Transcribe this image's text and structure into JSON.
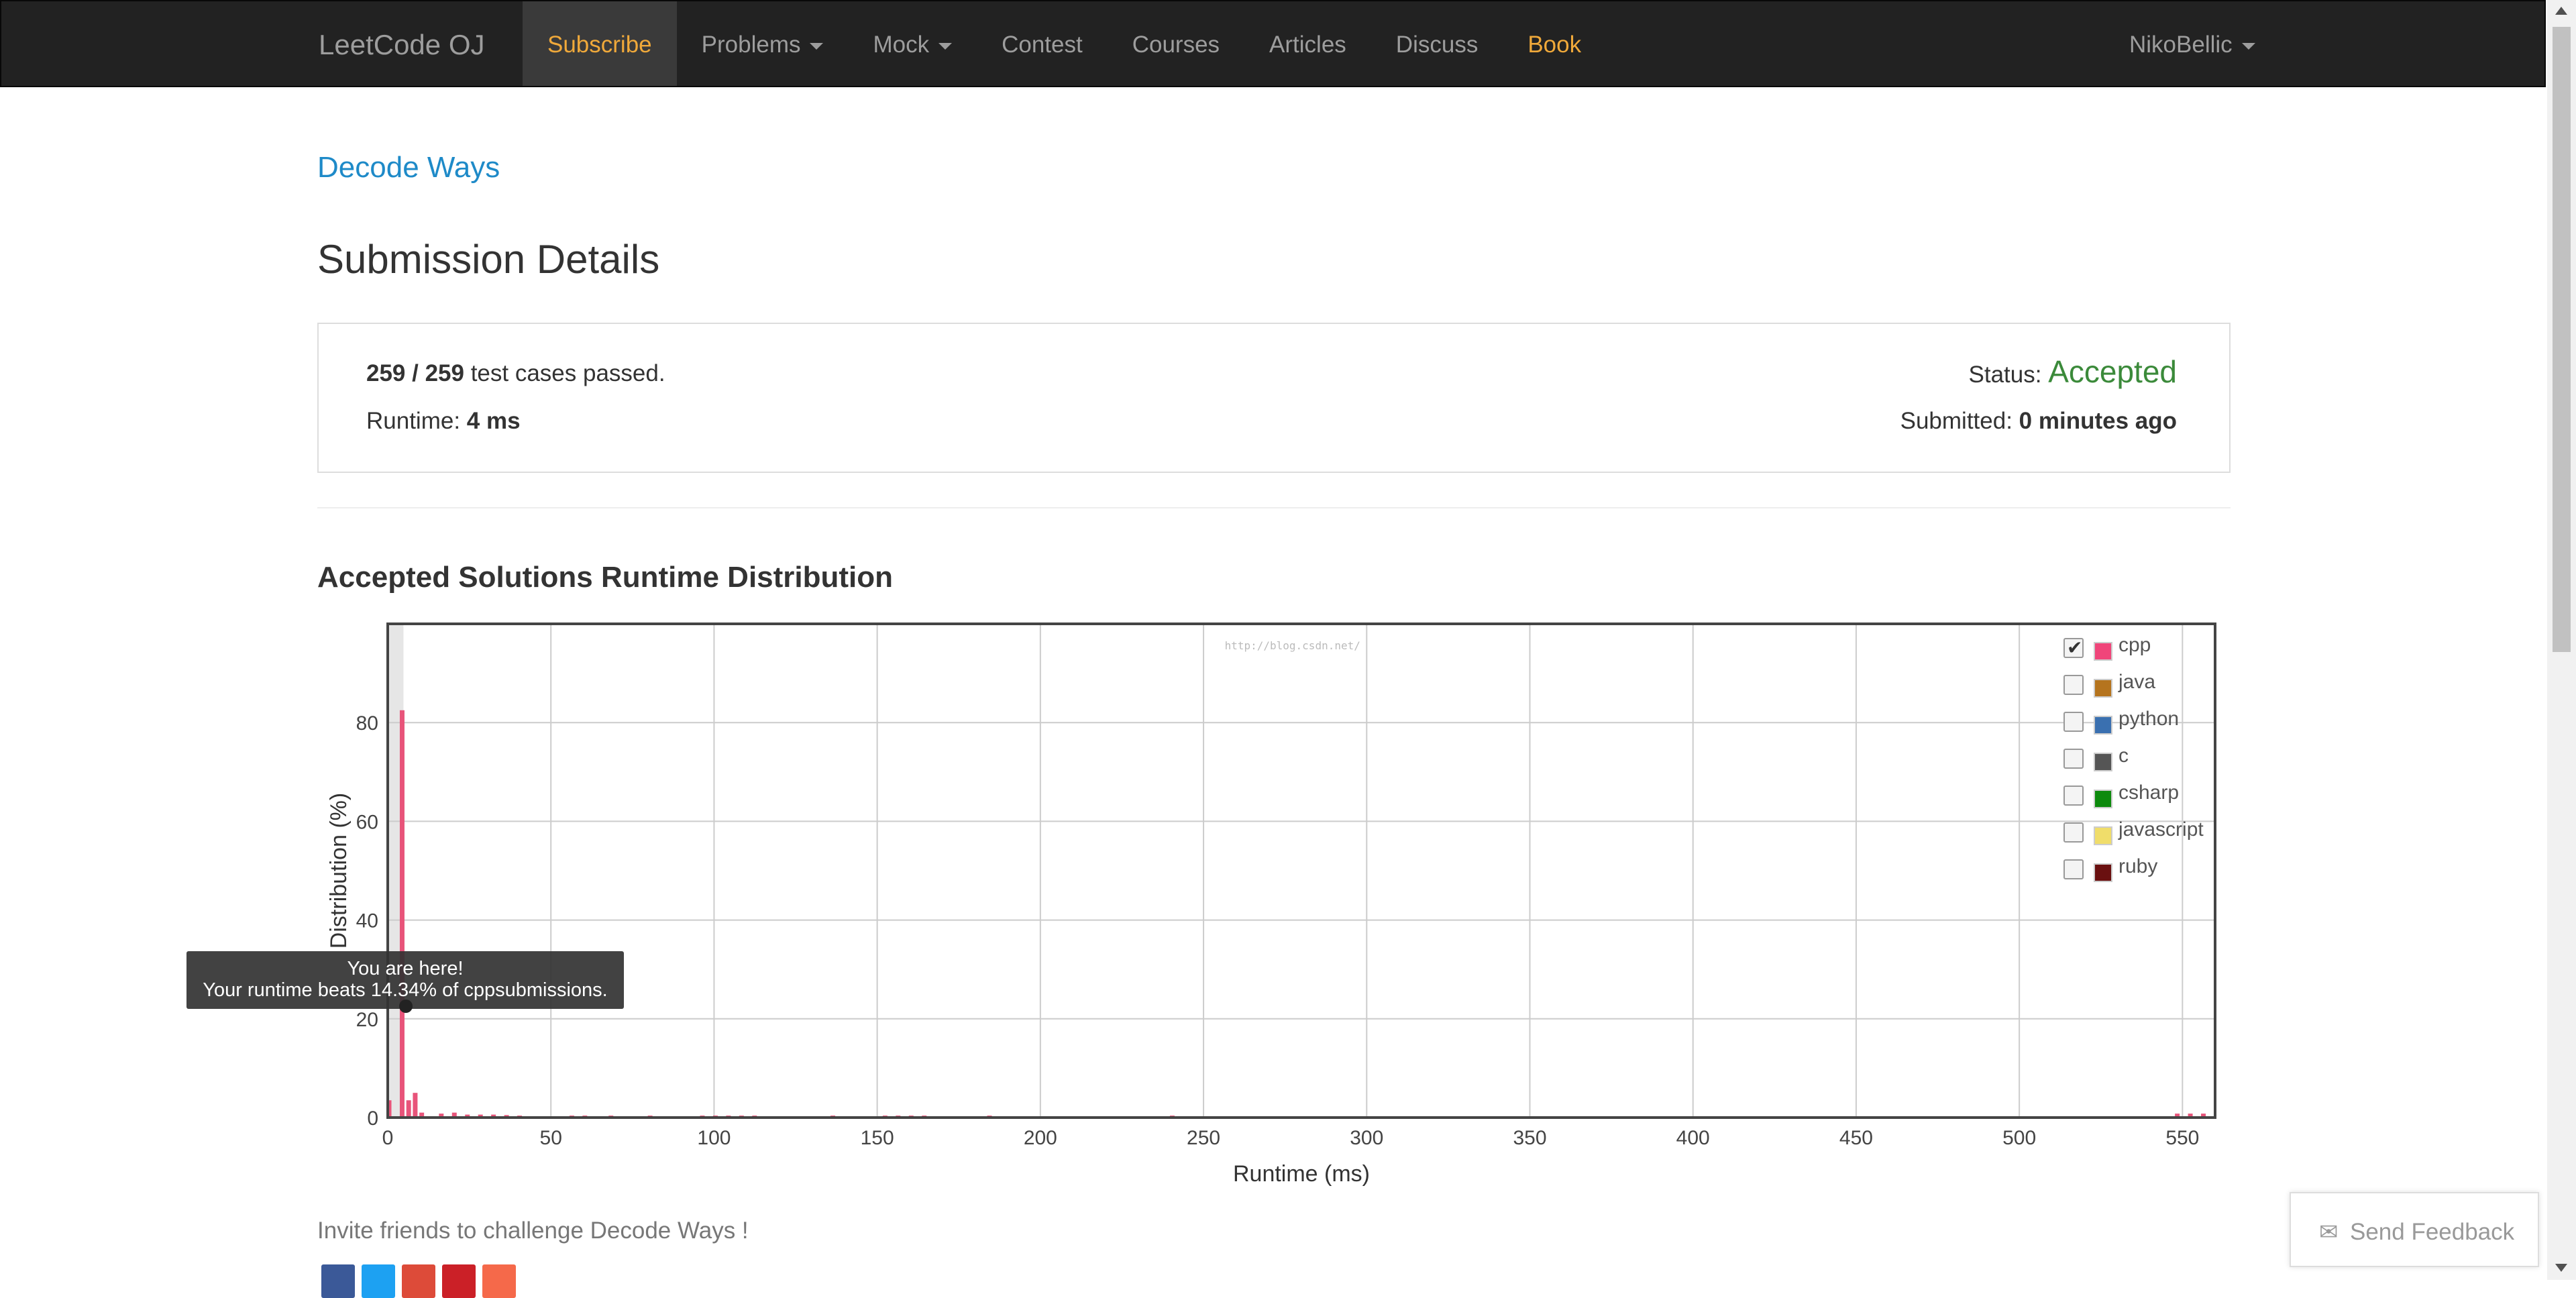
{
  "nav": {
    "brand": "LeetCode OJ",
    "items": [
      {
        "label": "Subscribe",
        "active": true,
        "caret": false
      },
      {
        "label": "Problems",
        "active": false,
        "caret": true
      },
      {
        "label": "Mock",
        "active": false,
        "caret": true
      },
      {
        "label": "Contest",
        "active": false,
        "caret": false
      },
      {
        "label": "Courses",
        "active": false,
        "caret": false
      },
      {
        "label": "Articles",
        "active": false,
        "caret": false
      },
      {
        "label": "Discuss",
        "active": false,
        "caret": false
      },
      {
        "label": "Book",
        "active": false,
        "caret": false
      }
    ],
    "user": "NikoBellic",
    "accent_color": "#f0a93a"
  },
  "problem": {
    "title": "Decode Ways"
  },
  "page": {
    "title": "Submission Details"
  },
  "summary": {
    "passed": "259 / 259",
    "passed_suffix": "test cases passed.",
    "runtime_label": "Runtime:",
    "runtime_value": "4 ms",
    "status_label": "Status:",
    "status_value": "Accepted",
    "status_color": "#3b8a3a",
    "submitted_label": "Submitted:",
    "submitted_value": "0 minutes ago"
  },
  "distribution": {
    "title": "Accepted Solutions Runtime Distribution"
  },
  "chart_data": {
    "type": "bar",
    "xlabel": "Runtime (ms)",
    "ylabel": "Distribution (%)",
    "xlim": [
      0,
      560
    ],
    "ylim": [
      0,
      100
    ],
    "x_ticks": [
      0,
      50,
      100,
      150,
      200,
      250,
      300,
      350,
      400,
      450,
      500,
      550
    ],
    "y_ticks": [
      0,
      20,
      40,
      60,
      80
    ],
    "grid": true,
    "legend_position": "top-right",
    "highlight_x": 4,
    "watermark": "http://blog.csdn.net/",
    "series": [
      {
        "name": "cpp",
        "color": "#e8547a",
        "points": [
          [
            0,
            3.5
          ],
          [
            4,
            82.5
          ],
          [
            6,
            3.5
          ],
          [
            8,
            5
          ],
          [
            10,
            1
          ],
          [
            16,
            0.8
          ],
          [
            20,
            1
          ],
          [
            24,
            0.6
          ],
          [
            28,
            0.6
          ],
          [
            32,
            0.6
          ],
          [
            36,
            0.5
          ],
          [
            40,
            0.4
          ],
          [
            56,
            0.4
          ],
          [
            60,
            0.4
          ],
          [
            68,
            0.4
          ],
          [
            80,
            0.4
          ],
          [
            96,
            0.4
          ],
          [
            100,
            0.4
          ],
          [
            104,
            0.4
          ],
          [
            108,
            0.4
          ],
          [
            112,
            0.4
          ],
          [
            136,
            0.4
          ],
          [
            152,
            0.4
          ],
          [
            156,
            0.4
          ],
          [
            160,
            0.4
          ],
          [
            164,
            0.4
          ],
          [
            184,
            0.4
          ],
          [
            240,
            0.4
          ],
          [
            548,
            0.8
          ],
          [
            552,
            0.8
          ],
          [
            556,
            0.8
          ]
        ]
      }
    ],
    "legend": [
      {
        "name": "cpp",
        "color": "#f0457a",
        "checked": true
      },
      {
        "name": "java",
        "color": "#b5741e",
        "checked": false
      },
      {
        "name": "python",
        "color": "#3a70b0",
        "checked": false
      },
      {
        "name": "c",
        "color": "#555555",
        "checked": false
      },
      {
        "name": "csharp",
        "color": "#0d8a0d",
        "checked": false
      },
      {
        "name": "javascript",
        "color": "#f0dd6a",
        "checked": false
      },
      {
        "name": "ruby",
        "color": "#6a1010",
        "checked": false
      }
    ],
    "tooltip": {
      "line1": "You are here!",
      "line2": "Your runtime beats 14.34% of cppsubmissions."
    }
  },
  "invite": {
    "text": "Invite friends to challenge Decode Ways !"
  },
  "share": [
    {
      "name": "facebook",
      "color": "#3b5998"
    },
    {
      "name": "twitter",
      "color": "#1da1f2"
    },
    {
      "name": "google-plus",
      "color": "#dd4b39"
    },
    {
      "name": "pinterest",
      "color": "#cb2027"
    },
    {
      "name": "more",
      "color": "#f5694a"
    }
  ],
  "feedback": {
    "label": "Send Feedback",
    "icon": "envelope-icon"
  }
}
